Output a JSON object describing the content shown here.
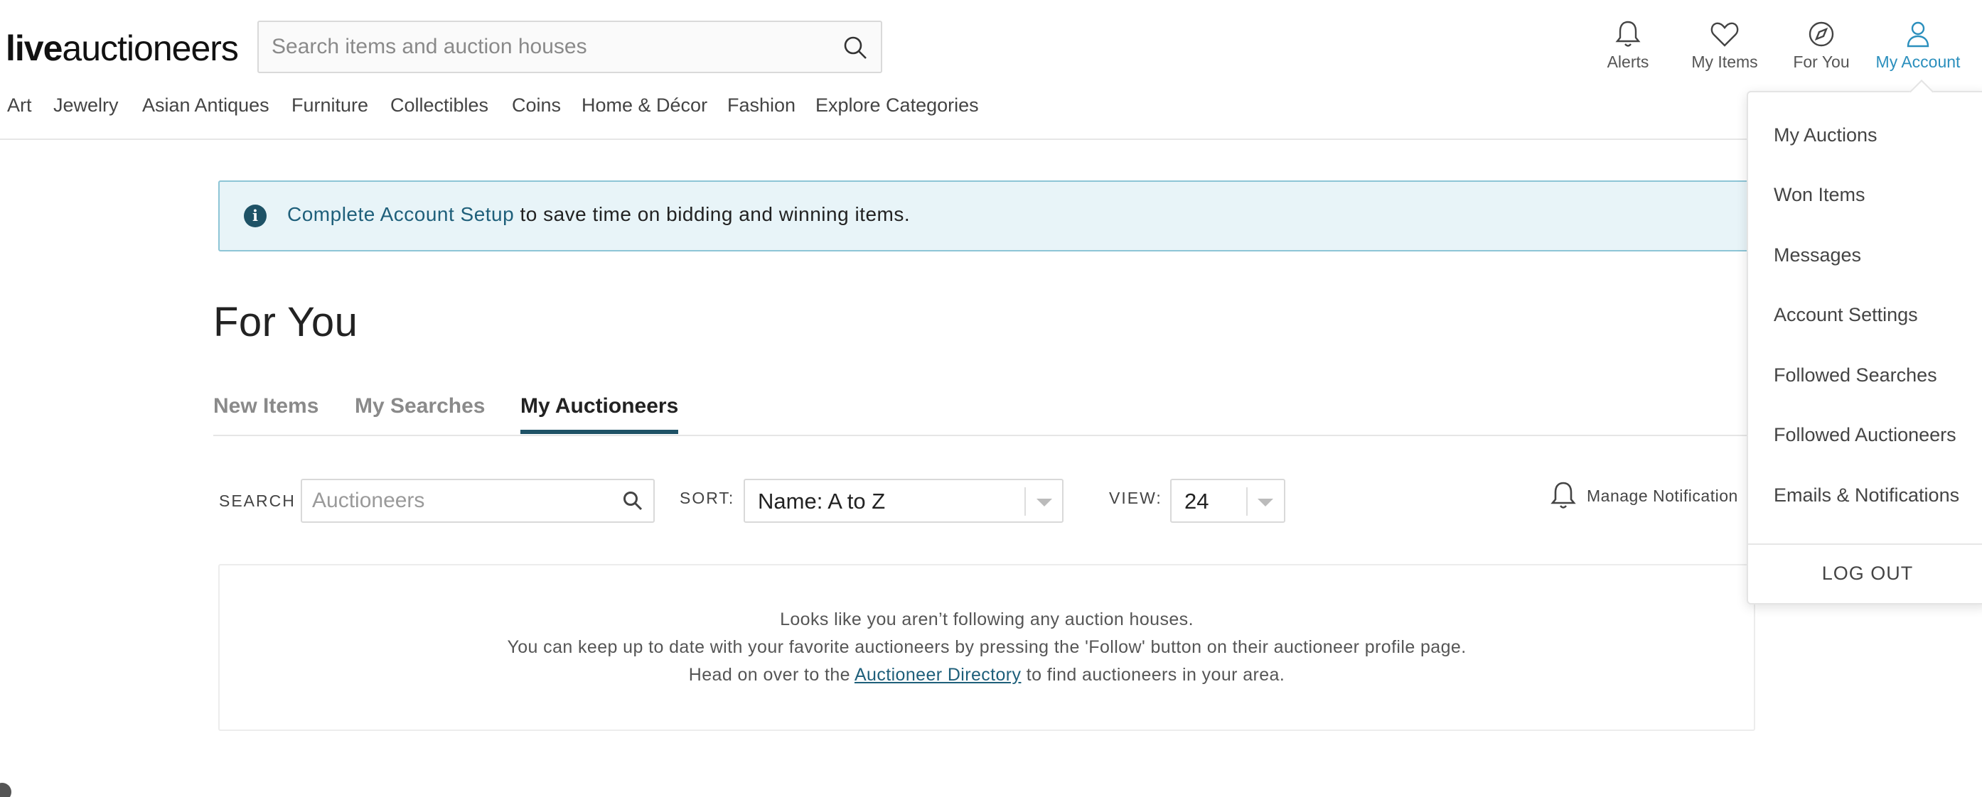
{
  "header": {
    "logo_bold": "live",
    "logo_rest": "auctioneers",
    "search_placeholder": "Search items and auction houses",
    "nav": [
      {
        "label": "Alerts",
        "icon": "bell-icon"
      },
      {
        "label": "My Items",
        "icon": "heart-icon"
      },
      {
        "label": "For You",
        "icon": "compass-icon"
      },
      {
        "label": "My Account",
        "icon": "user-icon"
      }
    ],
    "accent_color": "#2b8fbd"
  },
  "categories": [
    "Art",
    "Jewelry",
    "Asian Antiques",
    "Furniture",
    "Collectibles",
    "Coins",
    "Home & Décor",
    "Fashion",
    "Explore Categories"
  ],
  "banner": {
    "link": "Complete Account Setup",
    "text": " to save time on bidding and winning items."
  },
  "page_title": "For You",
  "tabs": [
    {
      "label": "New Items",
      "active": false
    },
    {
      "label": "My Searches",
      "active": false
    },
    {
      "label": "My Auctioneers",
      "active": true
    }
  ],
  "filters": {
    "search_label": "SEARCH",
    "search_placeholder": "Auctioneers",
    "sort_label": "SORT:",
    "sort_value": "Name: A to Z",
    "view_label": "VIEW:",
    "view_value": "24",
    "manage_label": "Manage Notification"
  },
  "empty_state": {
    "line1": "Looks like you aren’t following any auction houses.",
    "line2": "You can keep up to date with your favorite auctioneers by pressing the 'Follow' button on their auctioneer profile page.",
    "line3_pre": "Head on over to the ",
    "line3_link": "Auctioneer Directory",
    "line3_post": " to find auctioneers in your area."
  },
  "account_menu": {
    "items": [
      "My Auctions",
      "Won Items",
      "Messages",
      "Account Settings",
      "Followed Searches",
      "Followed Auctioneers",
      "Emails & Notifications"
    ],
    "logout": "LOG OUT"
  }
}
